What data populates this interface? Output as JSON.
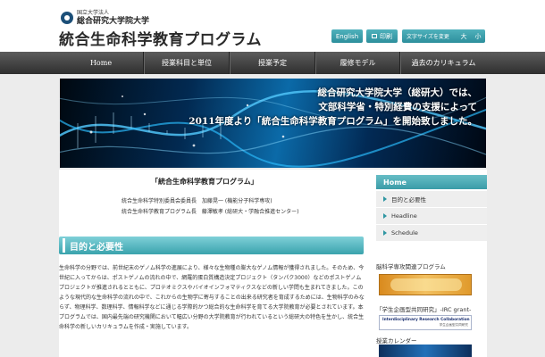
{
  "header": {
    "logo_small": "国立大学法人",
    "logo_univ": "総合研究大学院大学",
    "site_title": "統合生命科学教育プログラム",
    "btn_english": "English",
    "btn_print": "印刷",
    "fontsize_label": "文字サイズを変更",
    "fontsize_large": "大",
    "fontsize_small": "小"
  },
  "nav": {
    "items": [
      {
        "label": "Home"
      },
      {
        "label": "授業科目と単位"
      },
      {
        "label": "授業予定"
      },
      {
        "label": "履修モデル"
      },
      {
        "label": "過去のカリキュラム"
      }
    ]
  },
  "banner": {
    "lines": [
      "総合研究大学院大学（総研大）では、",
      "文部科学省・特別経費の支援によって",
      "2011年度より「統合生命科学教育プログラム」を開始致しました。"
    ]
  },
  "main": {
    "program_title": "「統合生命科学教育プログラム」",
    "person_1": "統合生命科学特別委員会委員長　加藤晃一 (機能分子科学専攻)",
    "person_2": "統合生命科学教育プログラム長　藤澤敏孝 (総研大・学融合推進センター)",
    "section_heading": "目的と必要性",
    "body_text": "生命科学の分野では、前世紀末のゲノム科学の進展により、様々な生物種の膨大なゲノム情報が獲得されました。そのため、今世紀に入ってからは、ポストゲノムの流れの中で、網羅的蛋白質構造決定プロジェクト（タンパク3000）などのポストゲノムプロジェクトが推進されるとともに、プロテオミクスやバイオインフォマティクスなどの新しい学問も生まれてきました。このような現代的な生命科学の流れの中で、これからの生物学に寄与することの出来る研究者を育成するためには、生物科学のみならず、物理科学、数理科学、情報科学などに通じる学際的かつ総合的な生命科学を育てる大学院教育が必要とされています。本プログラムでは、国内最先端の研究機関において幅広い分野の大学院教育が行われているという総研大の特色を生かし、統合生命科学の新しいカリキュラムを作成・実施しています。"
  },
  "sidebar": {
    "home_label": "Home",
    "items": [
      {
        "label": "目的と必要性"
      },
      {
        "label": "Headline"
      },
      {
        "label": "Schedule"
      }
    ],
    "label_1": "脳科学専攻関連プログラム",
    "label_2": "「学生企画型共同研究」-IRC grant-",
    "ad_2_text": "Interdisciplinary Research Collaboration grant",
    "ad_2_sub": "学生企画型共同研究",
    "label_3": "授業カレンダー"
  },
  "colors": {
    "accent": "#3aa3ad",
    "nav_bg": "#3a3a3a",
    "banner_bg": "#022a52"
  }
}
